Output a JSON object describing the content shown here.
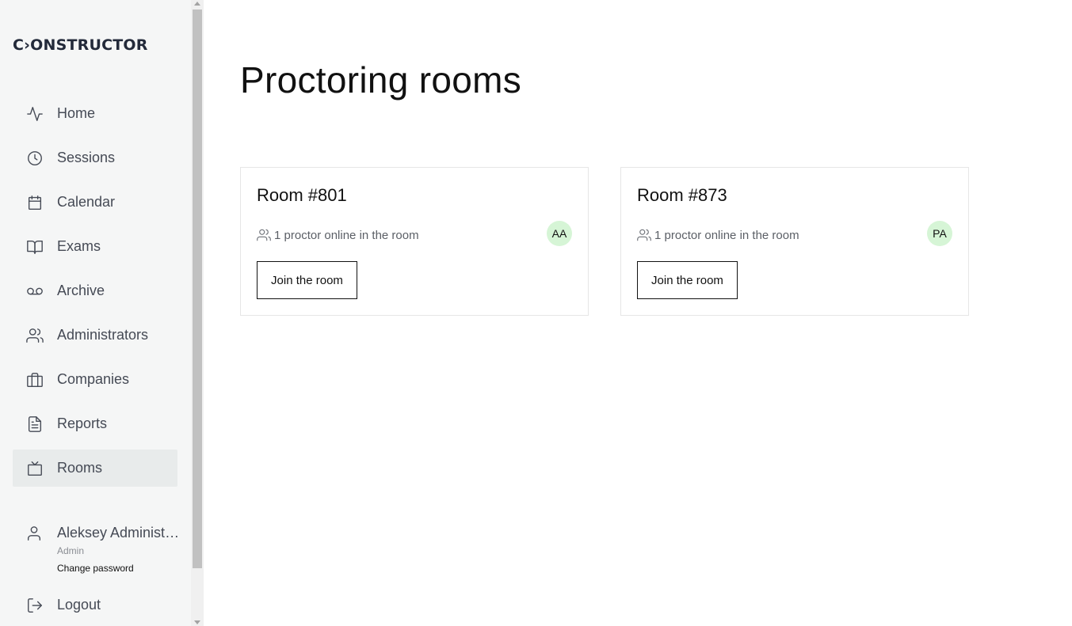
{
  "app": {
    "logo_text": "C›ONSTRUCTOR"
  },
  "sidebar": {
    "items": [
      {
        "label": "Home",
        "icon": "activity-icon"
      },
      {
        "label": "Sessions",
        "icon": "clock-icon"
      },
      {
        "label": "Calendar",
        "icon": "calendar-icon"
      },
      {
        "label": "Exams",
        "icon": "book-icon"
      },
      {
        "label": "Archive",
        "icon": "voicemail-icon"
      },
      {
        "label": "Administrators",
        "icon": "users-icon"
      },
      {
        "label": "Companies",
        "icon": "briefcase-icon"
      },
      {
        "label": "Reports",
        "icon": "file-text-icon"
      },
      {
        "label": "Rooms",
        "icon": "tv-icon",
        "active": true
      }
    ],
    "user": {
      "name": "Aleksey Administrator",
      "role": "Admin",
      "change_password": "Change password"
    },
    "logout_label": "Logout"
  },
  "main": {
    "title": "Proctoring rooms",
    "rooms": [
      {
        "title": "Room #801",
        "info": "1 proctor online in the room",
        "avatar": "AA",
        "button": "Join the room"
      },
      {
        "title": "Room #873",
        "info": "1 proctor online in the room",
        "avatar": "PA",
        "button": "Join the room"
      }
    ]
  },
  "colors": {
    "sidebar_bg": "#f5f6f6",
    "active_item_bg": "#e8ebeb",
    "avatar_bg": "#d6f5d6",
    "text_primary": "#111111",
    "text_nav": "#454a55"
  }
}
